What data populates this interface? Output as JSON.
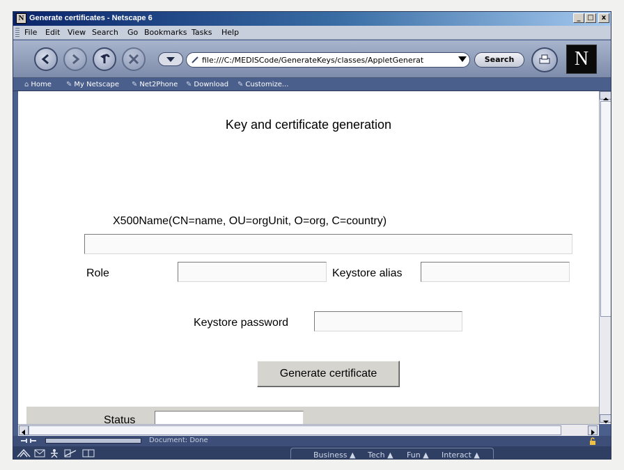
{
  "window": {
    "title": "Generate certificates - Netscape 6",
    "app_icon": "N",
    "minimize": "_",
    "maximize": "□",
    "close": "x"
  },
  "menu": [
    "File",
    "Edit",
    "View",
    "Search",
    "Go",
    "Bookmarks",
    "Tasks",
    "Help"
  ],
  "navigation": {
    "url": "file:///C:/MEDISCode/GenerateKeys/classes/AppletGenerat",
    "search_label": "Search",
    "logo": "N"
  },
  "personal_toolbar": [
    "Home",
    "My Netscape",
    "Net2Phone",
    "Download",
    "Customize..."
  ],
  "page": {
    "heading": "Key and certificate generation",
    "x500_label": "X500Name(CN=name, OU=orgUnit, O=org, C=country)",
    "x500_value": "",
    "role_label": "Role",
    "role_value": "",
    "alias_label": "Keystore alias",
    "alias_value": "",
    "password_label": "Keystore password",
    "password_value": "",
    "generate_button": "Generate certificate",
    "status_label": "Status",
    "status_value": ""
  },
  "statusbar": {
    "text": "Document: Done"
  },
  "taskbar": {
    "categories": [
      "Business",
      "Tech",
      "Fun",
      "Interact"
    ]
  },
  "colors": {
    "chrome": "#4a5f8c",
    "title_gradient_start": "#0a246a",
    "page_background": "#ffffff",
    "button_face": "#d6d4cf"
  }
}
